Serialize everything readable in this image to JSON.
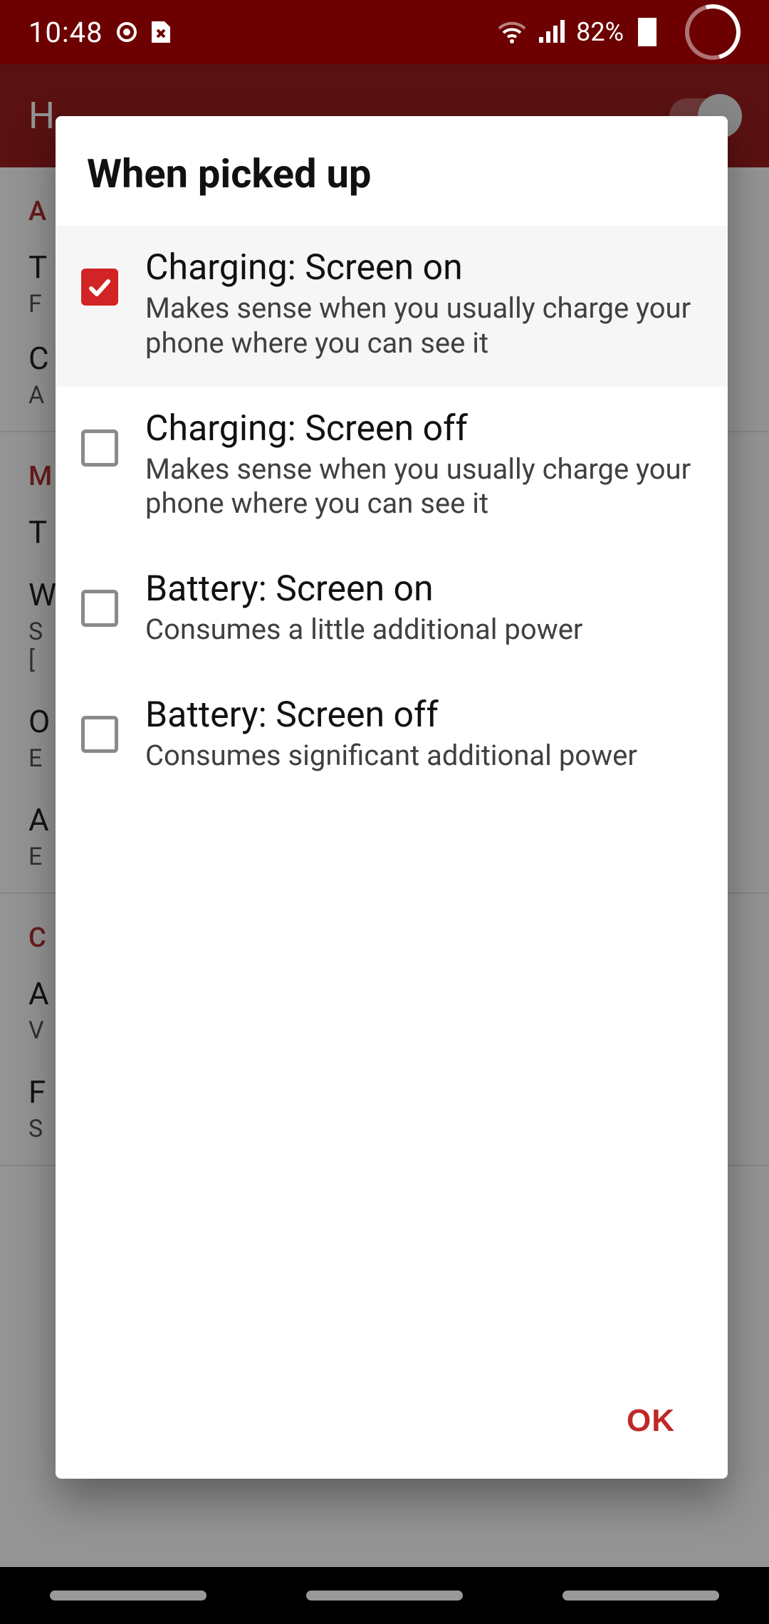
{
  "status": {
    "time": "10:48",
    "battery": "82%"
  },
  "appbar": {
    "title": "H"
  },
  "bg": {
    "h1": "A",
    "t1": "T",
    "s1": "F",
    "t2": "C",
    "s2": "A",
    "h3": "M",
    "t3": "T",
    "t4": "W",
    "s4a": "S",
    "s4b": "[",
    "t5": "O",
    "s5": "E",
    "t6": "A",
    "s6": "E",
    "h7": "C",
    "t7": "A",
    "s7": "V",
    "t8": "F",
    "s8": "S"
  },
  "dialog": {
    "title": "When picked up",
    "ok": "OK",
    "options": [
      {
        "checked": true,
        "title": "Charging: Screen on",
        "subtitle": "Makes sense when you usually charge your phone where you can see it"
      },
      {
        "checked": false,
        "title": "Charging: Screen off",
        "subtitle": "Makes sense when you usually charge your phone where you can see it"
      },
      {
        "checked": false,
        "title": "Battery: Screen on",
        "subtitle": "Consumes a little additional power"
      },
      {
        "checked": false,
        "title": "Battery: Screen off",
        "subtitle": "Consumes significant additional power"
      }
    ]
  }
}
